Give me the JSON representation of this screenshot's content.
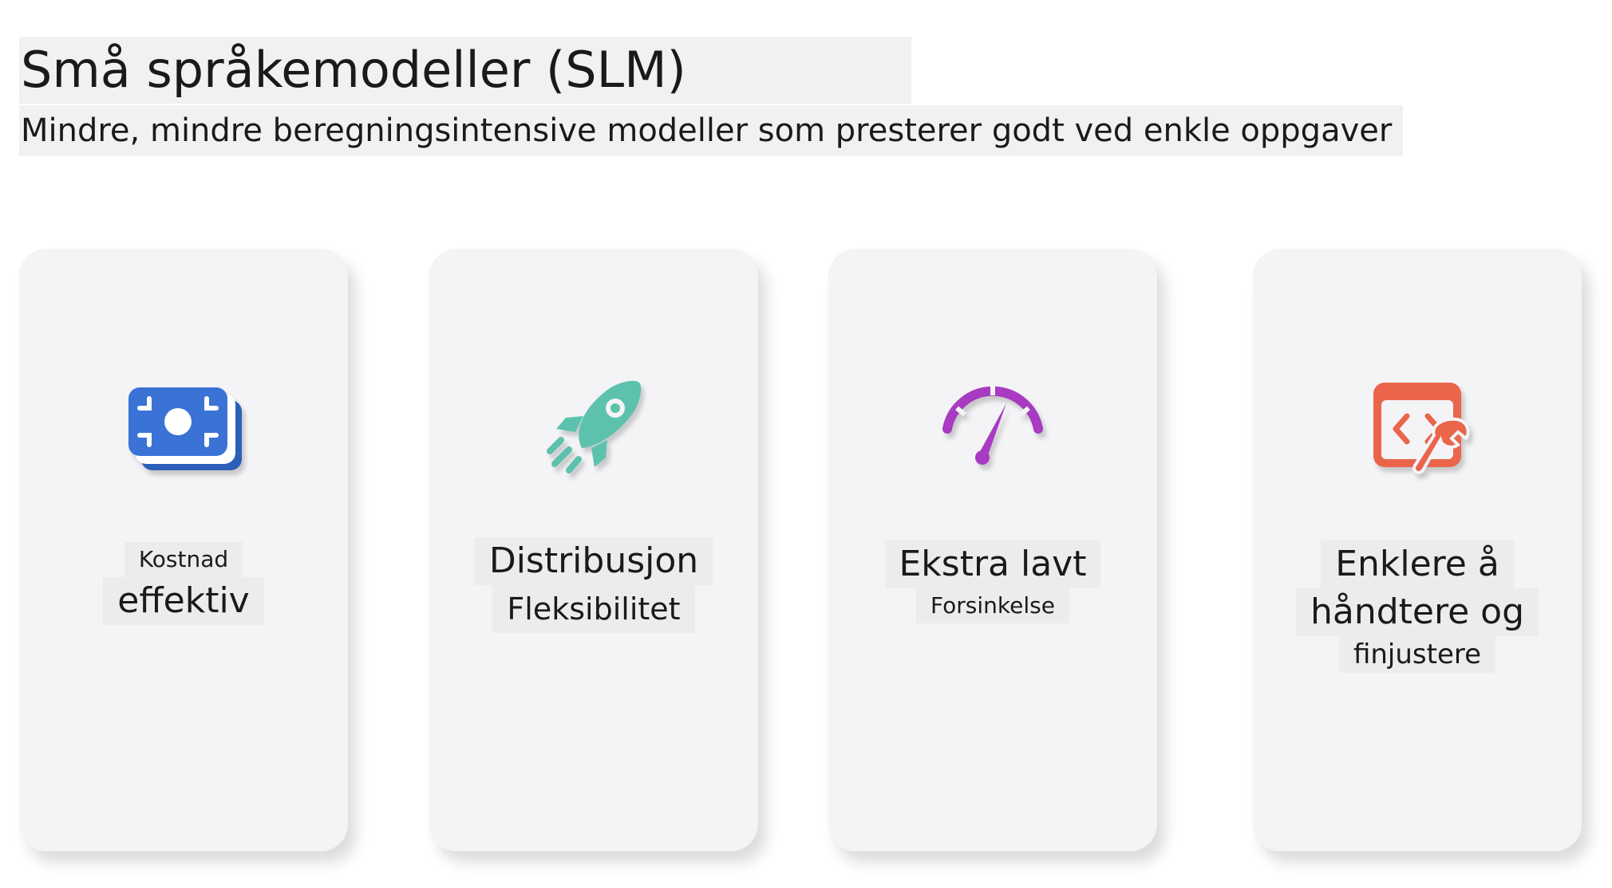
{
  "header": {
    "title": "Små språkemodeller (SLM)",
    "subtitle": "Mindre, mindre beregningsintensive modeller som presterer godt ved enkle oppgaver"
  },
  "cards": [
    {
      "icon": "money-icon",
      "icon_color": "#3a72d6",
      "lines": [
        "Kostnad",
        "effektiv"
      ]
    },
    {
      "icon": "rocket-icon",
      "icon_color": "#5cc2ae",
      "lines": [
        "Distribusjon",
        "Fleksibilitet"
      ]
    },
    {
      "icon": "speedometer-icon",
      "icon_color": "#a93ac2",
      "lines": [
        "Ekstra lavt",
        "Forsinkelse"
      ]
    },
    {
      "icon": "code-wrench-icon",
      "icon_color": "#ea654a",
      "lines": [
        "Enklere å",
        "håndtere og",
        "finjustere"
      ]
    }
  ]
}
